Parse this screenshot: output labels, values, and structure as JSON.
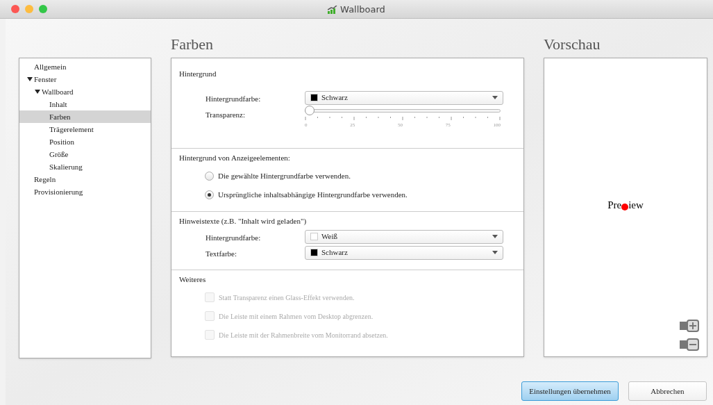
{
  "window": {
    "title": "Wallboard"
  },
  "sidebar": {
    "items": [
      {
        "label": "Allgemein",
        "selected": false
      },
      {
        "label": "Fenster",
        "selected": false,
        "expanded": true,
        "children": [
          {
            "label": "Wallboard",
            "selected": false,
            "expanded": true,
            "children": [
              {
                "label": "Inhalt",
                "selected": false
              },
              {
                "label": "Farben",
                "selected": true
              },
              {
                "label": "Trägerelement",
                "selected": false
              },
              {
                "label": "Position",
                "selected": false
              },
              {
                "label": "Größe",
                "selected": false
              },
              {
                "label": "Skalierung",
                "selected": false
              }
            ]
          }
        ]
      },
      {
        "label": "Regeln",
        "selected": false
      },
      {
        "label": "Provisionierung",
        "selected": false
      }
    ]
  },
  "main": {
    "heading": "Farben",
    "sections": [
      {
        "title": "Hintergrund",
        "rows": [
          {
            "kind": "select",
            "label": "Hintergrundfarbe:",
            "value": "Schwarz",
            "color": "#000000"
          },
          {
            "kind": "slider",
            "label": "Transparenz:",
            "level": 0,
            "tick_labels": [
              "0",
              "25",
              "50",
              "75",
              "100"
            ]
          }
        ]
      },
      {
        "title": "Hintergrund von Anzeigeelementen:",
        "rows": [
          {
            "kind": "radio",
            "label": "Die gewählte Hintergrundfarbe verwenden.",
            "selected": false
          },
          {
            "kind": "radio",
            "label": "Ursprüngliche inhaltsabhängige Hintergrundfarbe verwenden.",
            "selected": true
          }
        ]
      },
      {
        "title": "Hinweistexte (z.B. \"Inhalt wird geladen\")",
        "rows": [
          {
            "kind": "select",
            "label": "Hintergrundfarbe:",
            "value": "Weiß",
            "color": "#ffffff"
          },
          {
            "kind": "select",
            "label": "Textfarbe:",
            "value": "Schwarz",
            "color": "#000000"
          }
        ]
      },
      {
        "title": "Weiteres",
        "rows": [
          {
            "kind": "checkbox",
            "label": "Statt Transparenz einen Glass-Effekt verwenden.",
            "checked": false,
            "disabled": true
          },
          {
            "kind": "checkbox",
            "label": "Die Leiste mit einem Rahmen vom Desktop abgrenzen.",
            "checked": false,
            "disabled": true
          },
          {
            "kind": "checkbox",
            "label": "Die Leiste mit der Rahmenbreite vom Monitorrand absetzen.",
            "checked": false,
            "disabled": true
          }
        ]
      }
    ]
  },
  "preview": {
    "heading": "Vorschau",
    "text_parts": [
      "Pre",
      "iew"
    ]
  },
  "buttons": [
    {
      "label": "Einstellungen übernehmen",
      "default": true
    },
    {
      "label": "Abbrechen",
      "default": false
    }
  ]
}
